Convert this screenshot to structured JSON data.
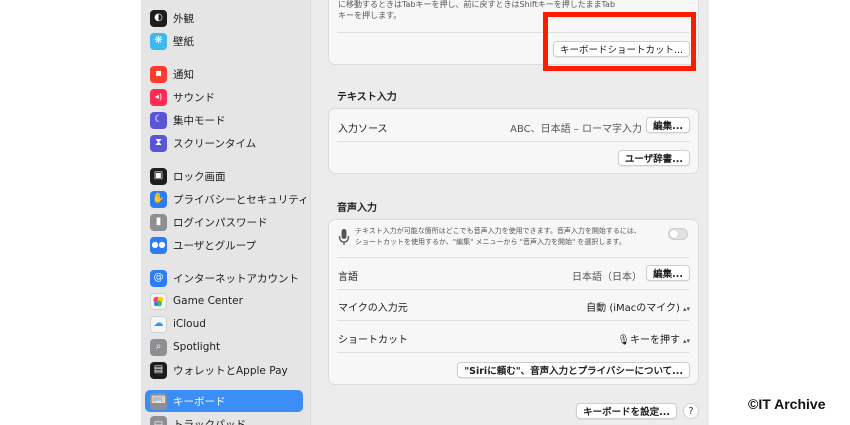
{
  "sidebar": {
    "items": [
      {
        "label": "外観",
        "icon": "appearance-icon",
        "color": "#1d1d1f",
        "glyph": "◐"
      },
      {
        "label": "壁紙",
        "icon": "wallpaper-icon",
        "color": "#3fb8f0",
        "glyph": "❋"
      },
      {
        "label": "通知",
        "icon": "notifications-icon",
        "color": "#ff3b30",
        "glyph": "▪"
      },
      {
        "label": "サウンド",
        "icon": "sound-icon",
        "color": "#ff2d55",
        "glyph": "◂)"
      },
      {
        "label": "集中モード",
        "icon": "focus-icon",
        "color": "#5856d6",
        "glyph": "☾"
      },
      {
        "label": "スクリーンタイム",
        "icon": "screen-time-icon",
        "color": "#5856d6",
        "glyph": "⧗"
      },
      {
        "label": "ロック画面",
        "icon": "lock-screen-icon",
        "color": "#1d1d1f",
        "glyph": "▣"
      },
      {
        "label": "プライバシーとセキュリティ",
        "icon": "privacy-hand-icon",
        "color": "#2b7cf6",
        "glyph": "✋"
      },
      {
        "label": "ログインパスワード",
        "icon": "lock-icon",
        "color": "#8e8e93",
        "glyph": "▮"
      },
      {
        "label": "ユーザとグループ",
        "icon": "users-icon",
        "color": "#2b7cf6",
        "glyph": "👥"
      },
      {
        "label": "インターネットアカウント",
        "icon": "at-sign-icon",
        "color": "#2b7cf6",
        "glyph": "@"
      },
      {
        "label": "Game Center",
        "icon": "game-center-icon",
        "color": "#f5f5f5",
        "glyph": "●"
      },
      {
        "label": "iCloud",
        "icon": "icloud-icon",
        "color": "#f5f5f5",
        "glyph": "☁"
      },
      {
        "label": "Spotlight",
        "icon": "spotlight-search-icon",
        "color": "#8e8e93",
        "glyph": "⌕"
      },
      {
        "label": "ウォレットとApple Pay",
        "icon": "wallet-icon",
        "color": "#1d1d1f",
        "glyph": "▤"
      },
      {
        "label": "キーボード",
        "icon": "keyboard-icon",
        "color": "#8e8e93",
        "glyph": "⌨"
      },
      {
        "label": "トラックパッド",
        "icon": "trackpad-icon",
        "color": "#8e8e93",
        "glyph": "▭"
      }
    ],
    "selected": "キーボード"
  },
  "top_panel": {
    "note_line1": "に移動するときはTabキーを押し、前に戻すときはShiftキーを押したままTab",
    "note_line2": "キーを押します。",
    "shortcuts_button": "キーボードショートカット..."
  },
  "text_input": {
    "title": "テキスト入力",
    "input_sources_label": "入力ソース",
    "input_sources_value": "ABC、日本語 – ローマ字入力",
    "edit_button": "編集...",
    "user_dictionary_button": "ユーザ辞書..."
  },
  "dictation": {
    "title": "音声入力",
    "description_line1": "テキスト入力が可能な箇所はどこでも音声入力を使用できます。音声入力を開始するには、",
    "description_line2": "ショートカットを使用するか、\"編集\" メニューから \"音声入力を開始\" を選択します。",
    "toggle_on": false,
    "language_label": "言語",
    "language_value": "日本語（日本）",
    "language_edit_button": "編集...",
    "mic_source_label": "マイクの入力元",
    "mic_source_value": "自動 (iMacのマイク)",
    "shortcut_label": "ショートカット",
    "shortcut_value": "🎙キーを押す",
    "siri_privacy_button": "\"Siriに頼む\"、音声入力とプライバシーについて..."
  },
  "footer": {
    "setup_keyboard_button": "キーボードを設定...",
    "help_button": "?"
  },
  "watermark": "©IT Archive",
  "colors": {
    "accent": "#3a8ef6",
    "highlight_border": "#ff1b00"
  }
}
